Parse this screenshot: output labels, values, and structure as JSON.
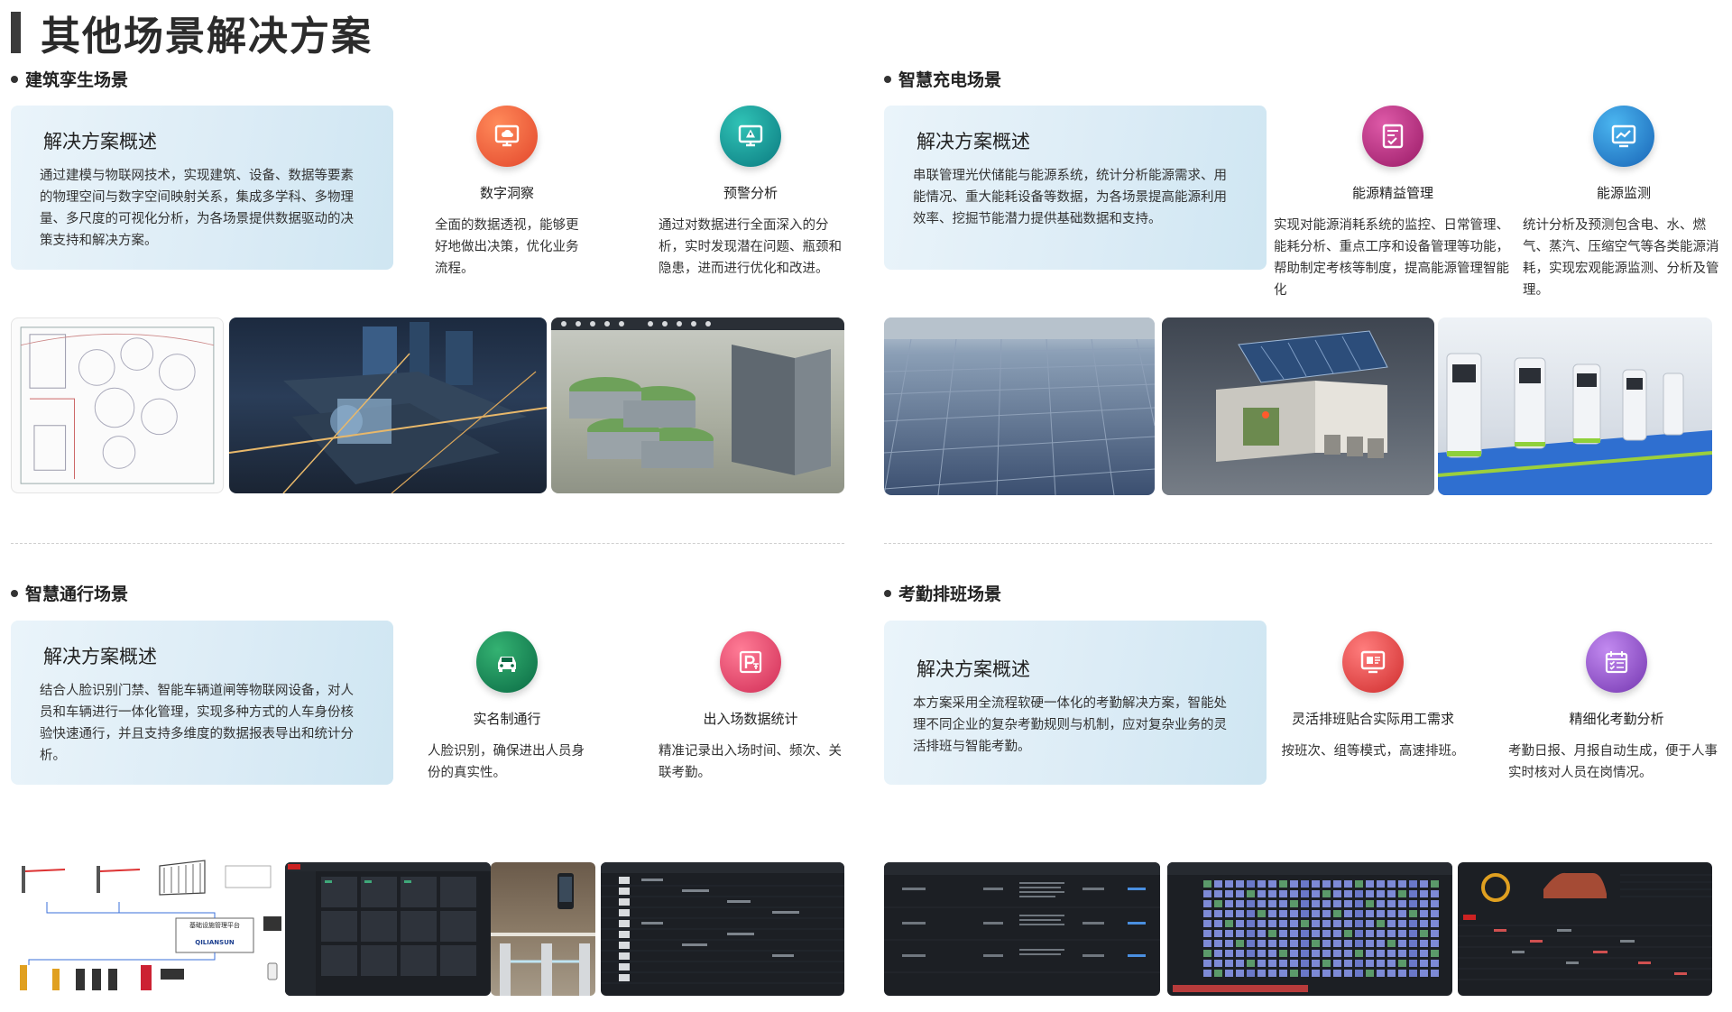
{
  "page_title": "其他场景解决方案",
  "overview_title": "解决方案概述",
  "sections": {
    "building": {
      "heading": "建筑孪生场景",
      "overview": "通过建模与物联网技术，实现建筑、设备、数据等要素的物理空间与数字空间映射关系，集成多学科、多物理量、多尺度的可视化分析，为各场景提供数据驱动的决策支持和解决方案。",
      "features": [
        {
          "title": "数字洞察",
          "desc": "全面的数据透视，能够更好地做出决策，优化业务流程。",
          "icon": "monitor-cloud-icon",
          "color_a": "#ff7a4a",
          "color_b": "#e2462b"
        },
        {
          "title": "预警分析",
          "desc": "通过对数据进行全面深入的分析，实时发现潜在问题、瓶颈和隐患，进而进行优化和改进。",
          "icon": "monitor-warning-icon",
          "color_a": "#28b3a8",
          "color_b": "#0e7f85"
        }
      ]
    },
    "charging": {
      "heading": "智慧充电场景",
      "overview": "串联管理光伏储能与能源系统，统计分析能源需求、用能情况、重大能耗设备等数据，为各场景提高能源利用效率、挖掘节能潜力提供基础数据和支持。",
      "features": [
        {
          "title": "能源精益管理",
          "desc": "实现对能源消耗系统的监控、日常管理、能耗分析、重点工序和设备管理等功能，帮助制定考核等制度，提高能源管理智能化",
          "icon": "document-check-icon",
          "color_a": "#d34a9a",
          "color_b": "#a21f6d"
        },
        {
          "title": "能源监测",
          "desc": "统计分析及预测包含电、水、燃气、蒸汽、压缩空气等各类能源消耗，实现宏观能源监测、分析及管理。",
          "icon": "chart-monitor-icon",
          "color_a": "#3aa7e6",
          "color_b": "#1a6fc0"
        }
      ]
    },
    "access": {
      "heading": "智慧通行场景",
      "overview": "结合人脸识别门禁、智能车辆道闸等物联网设备，对人员和车辆进行一体化管理，实现多种方式的人车身份核验快速通行，并且支持多维度的数据报表导出和统计分析。",
      "features": [
        {
          "title": "实名制通行",
          "desc": "人脸识别，确保进出人员身份的真实性。",
          "icon": "car-icon",
          "color_a": "#2aa067",
          "color_b": "#0c6f47"
        },
        {
          "title": "出入场数据统计",
          "desc": "精准记录出入场时间、频次、关联考勤。",
          "icon": "parking-fee-icon",
          "color_a": "#ff6a8a",
          "color_b": "#d9345a"
        }
      ]
    },
    "attendance": {
      "heading": "考勤排班场景",
      "overview": "本方案采用全流程软硬一体化的考勤解决方案，智能处理不同企业的复杂考勤规则与机制，应对复杂业务的灵活排班与智能考勤。",
      "features": [
        {
          "title": "灵活排班贴合实际用工需求",
          "desc": "按班次、组等模式，高速排班。",
          "icon": "schedule-screen-icon",
          "color_a": "#ff6b6b",
          "color_b": "#d93a3a"
        },
        {
          "title": "精细化考勤分析",
          "desc": "考勤日报、月报自动生成，便于人事实时核对人员在岗情况。",
          "icon": "calendar-check-icon",
          "color_a": "#b27be0",
          "color_b": "#7a40b8"
        }
      ]
    }
  },
  "diagram": {
    "platform_label": "基础设施管理平台",
    "brand_label": "QILIANSUN"
  }
}
